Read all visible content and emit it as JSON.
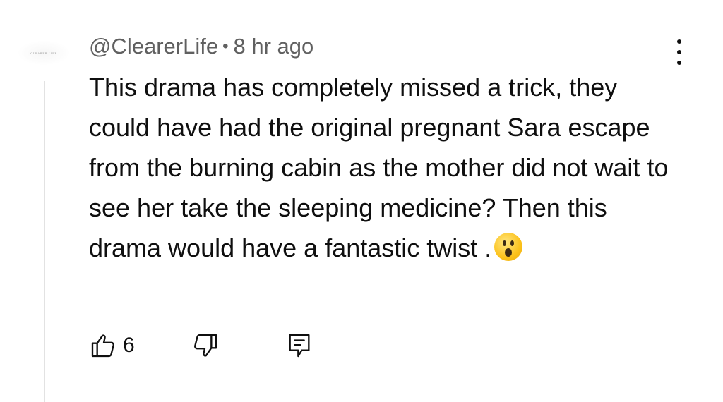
{
  "comment": {
    "author": "@ClearerLife",
    "separator": "•",
    "time": "8 hr ago",
    "avatar_text": "CLEARER LIFE",
    "text": "This drama has completely missed a trick, they could have had the original pregnant Sara escape from the burning cabin as the mother did not wait to see her take the sleeping medicine? Then this drama would have a fantastic twist .",
    "emoji": "hushed-face",
    "like_count": "6"
  },
  "icons": {
    "like": "thumbs-up-icon",
    "dislike": "thumbs-down-icon",
    "reply": "reply-comment-icon",
    "menu": "more-vertical-icon"
  },
  "colors": {
    "text": "#0f0f0f",
    "meta": "#606060",
    "thread_line": "#e2e2e2",
    "emoji": "#fcc21b"
  }
}
